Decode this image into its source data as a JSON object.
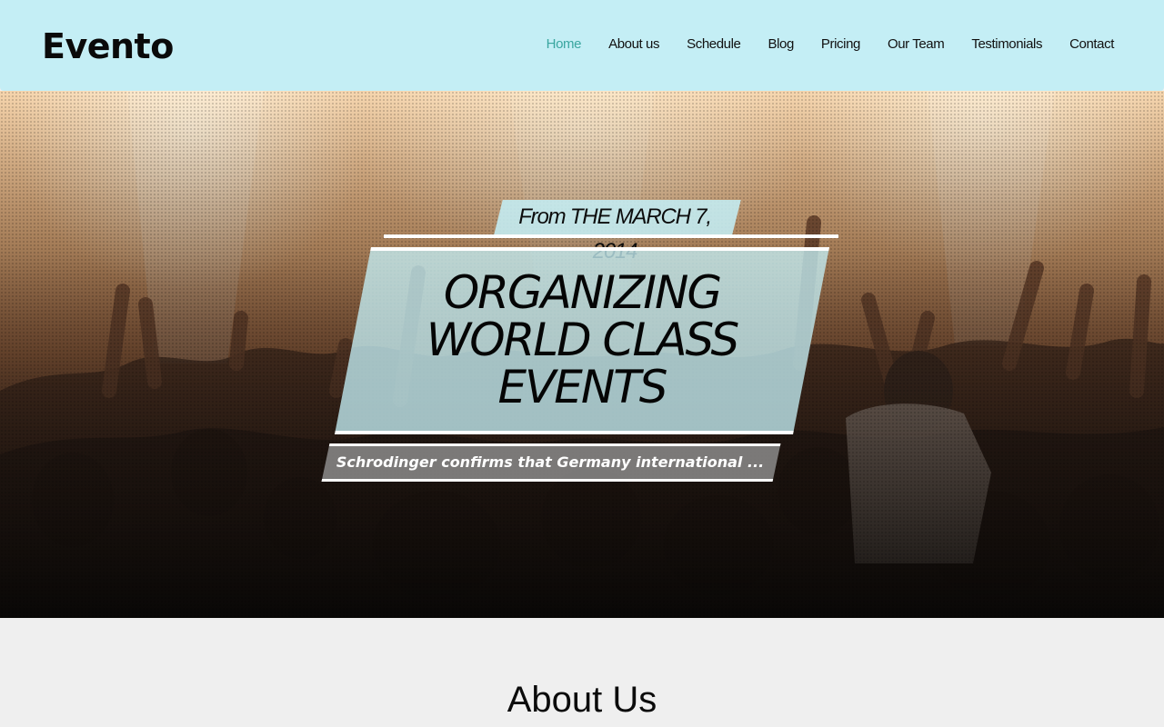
{
  "header": {
    "logo": "Evento",
    "nav": [
      {
        "label": "Home",
        "active": true
      },
      {
        "label": "About us",
        "active": false
      },
      {
        "label": "Schedule",
        "active": false
      },
      {
        "label": "Blog",
        "active": false
      },
      {
        "label": "Pricing",
        "active": false
      },
      {
        "label": "Our Team",
        "active": false
      },
      {
        "label": "Testimonials",
        "active": false
      },
      {
        "label": "Contact",
        "active": false
      }
    ]
  },
  "hero": {
    "date": "From THE MARCH 7, 2014",
    "headline_lines": [
      "ORGANIZING",
      "WORLD CLASS",
      "EVENTS"
    ],
    "subtitle": "Schrodinger confirms that Germany international ..."
  },
  "about": {
    "title": "About Us"
  },
  "colors": {
    "header_bg": "#c4eef5",
    "nav_active": "#3aa6a0",
    "panel_bg": "#c4eef5",
    "page_bg": "#efefef"
  }
}
